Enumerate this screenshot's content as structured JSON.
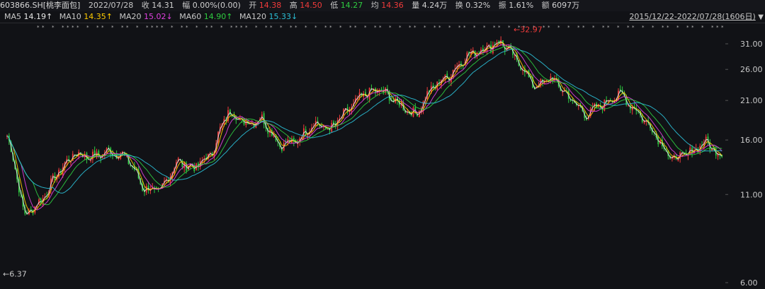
{
  "header": {
    "stock": "603866.SH[桃李面包]",
    "date": "2022/07/28",
    "close_label": "收",
    "close": "14.31",
    "change_label": "幅",
    "change": "0.00%(0.00)",
    "open_label": "开",
    "open": "14.38",
    "high_label": "高",
    "high": "14.50",
    "low_label": "低",
    "low": "14.27",
    "avg_label": "均",
    "avg": "14.36",
    "vol_label": "量",
    "vol": "4.24万",
    "turn_label": "换",
    "turn": "0.32%",
    "amp_label": "振",
    "amp": "1.61%",
    "amt_label": "额",
    "amt": "6097万"
  },
  "ma_bar": {
    "ma5_label": "MA5",
    "ma5": "14.19↑",
    "ma10_label": "MA10",
    "ma10": "14.35↑",
    "ma20_label": "MA20",
    "ma20": "15.02↓",
    "ma60_label": "MA60",
    "ma60": "14.90↑",
    "ma120_label": "MA120",
    "ma120": "15.33↓",
    "range": "2015/12/22-2022/07/28(1606日)"
  },
  "colors": {
    "up": "#f23b3b",
    "down": "#2ecc40",
    "ma5": "#e8e8e8",
    "ma10": "#ffcc00",
    "ma20": "#e040e0",
    "ma60": "#2ecc40",
    "ma120": "#2bbfd6",
    "bg": "#111216"
  },
  "chart_data": {
    "type": "candlestick",
    "title": "",
    "x_range": [
      "2015/12/22",
      "2022/07/28"
    ],
    "ylim": [
      6.0,
      34.0
    ],
    "y_scale": "log",
    "y_ticks": [
      "31.00",
      "26.00",
      "21.00",
      "16.00",
      "11.00",
      "6.00"
    ],
    "annotations": {
      "max_label": "32.97",
      "min_label": "6.37"
    },
    "close_path": [
      {
        "x": "2015/12",
        "y": 16.5
      },
      {
        "x": "2016/01",
        "y": 9.5
      },
      {
        "x": "2016/03",
        "y": 10.5
      },
      {
        "x": "2016/06",
        "y": 12.8
      },
      {
        "x": "2016/09",
        "y": 14.6
      },
      {
        "x": "2016/12",
        "y": 14.2
      },
      {
        "x": "2017/03",
        "y": 14.8
      },
      {
        "x": "2017/06",
        "y": 14.3
      },
      {
        "x": "2017/09",
        "y": 11.5
      },
      {
        "x": "2017/12",
        "y": 11.2
      },
      {
        "x": "2018/02",
        "y": 13.8
      },
      {
        "x": "2018/05",
        "y": 13.2
      },
      {
        "x": "2018/07",
        "y": 14.5
      },
      {
        "x": "2018/09",
        "y": 19.5
      },
      {
        "x": "2018/11",
        "y": 18.0
      },
      {
        "x": "2019/01",
        "y": 18.5
      },
      {
        "x": "2019/02",
        "y": 15.5
      },
      {
        "x": "2019/04",
        "y": 15.8
      },
      {
        "x": "2019/06",
        "y": 18.0
      },
      {
        "x": "2019/08",
        "y": 17.2
      },
      {
        "x": "2019/10",
        "y": 19.5
      },
      {
        "x": "2019/12",
        "y": 22.0
      },
      {
        "x": "2020/02",
        "y": 22.5
      },
      {
        "x": "2020/04",
        "y": 20.5
      },
      {
        "x": "2020/06",
        "y": 19.0
      },
      {
        "x": "2020/08",
        "y": 23.0
      },
      {
        "x": "2020/10",
        "y": 25.0
      },
      {
        "x": "2020/12",
        "y": 28.5
      },
      {
        "x": "2021/01",
        "y": 30.0
      },
      {
        "x": "2021/02",
        "y": 31.5
      },
      {
        "x": "2021/03",
        "y": 27.5
      },
      {
        "x": "2021/04",
        "y": 23.0
      },
      {
        "x": "2021/06",
        "y": 24.5
      },
      {
        "x": "2021/07",
        "y": 21.5
      },
      {
        "x": "2021/09",
        "y": 19.0
      },
      {
        "x": "2021/11",
        "y": 20.5
      },
      {
        "x": "2021/12",
        "y": 22.0
      },
      {
        "x": "2022/02",
        "y": 19.5
      },
      {
        "x": "2022/03",
        "y": 17.0
      },
      {
        "x": "2022/04",
        "y": 14.0
      },
      {
        "x": "2022/05",
        "y": 14.5
      },
      {
        "x": "2022/06",
        "y": 15.8
      },
      {
        "x": "2022/07",
        "y": 14.31
      }
    ],
    "series": [
      {
        "name": "MA5",
        "values": [
          14.19
        ]
      },
      {
        "name": "MA10",
        "values": [
          14.35
        ]
      },
      {
        "name": "MA20",
        "values": [
          15.02
        ]
      },
      {
        "name": "MA60",
        "values": [
          14.9
        ]
      },
      {
        "name": "MA120",
        "values": [
          15.33
        ]
      }
    ]
  }
}
